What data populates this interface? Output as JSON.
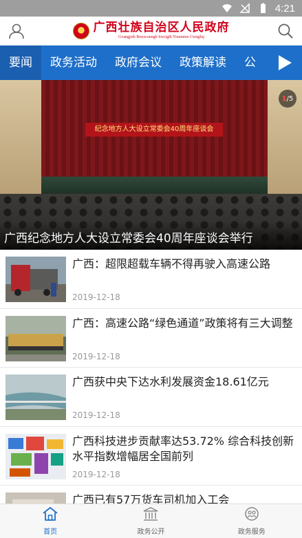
{
  "status_bar": {
    "time": "4:21",
    "icons": [
      "wifi-icon",
      "signal-off-icon",
      "battery-icon"
    ]
  },
  "header": {
    "title": "广西壮族自治区人民政府",
    "subtitle": "Gvangjsih Bouxcuengh Swcigih Yinzminz Cwngfuj",
    "left_icon": "user-icon",
    "right_icon": "search-icon"
  },
  "tabs": [
    {
      "label": "要闻",
      "active": true
    },
    {
      "label": "政务活动",
      "active": false
    },
    {
      "label": "政府会议",
      "active": false
    },
    {
      "label": "政策解读",
      "active": false
    },
    {
      "label": "公",
      "active": false
    }
  ],
  "hero": {
    "caption": "广西纪念地方人大设立常委会40周年座谈会举行",
    "banner_text": "纪念地方人大设立常委会40周年座谈会",
    "pager_current": "1",
    "pager_total": "/5"
  },
  "news": [
    {
      "title": "广西：超限超载车辆不得再驶入高速公路",
      "date": "2019-12-18",
      "thumb": "truck"
    },
    {
      "title": "广西：高速公路“绿色通道”政策将有三大调整",
      "date": "2019-12-18",
      "thumb": "highway"
    },
    {
      "title": "广西获中央下达水利发展资金18.61亿元",
      "date": "2019-12-18",
      "thumb": "river"
    },
    {
      "title": "广西科技进步贡献率达53.72% 综合科技创新水平指数增幅居全国前列",
      "date": "2019-12-18",
      "thumb": "tech"
    },
    {
      "title": "广西已有57万货车司机加入工会",
      "date": "",
      "thumb": "truck2"
    }
  ],
  "bottom_nav": [
    {
      "label": "首页",
      "icon": "home-icon",
      "active": true
    },
    {
      "label": "政务公开",
      "icon": "building-icon",
      "active": false
    },
    {
      "label": "政务服务",
      "icon": "service-icon",
      "active": false
    }
  ],
  "colors": {
    "brand_blue": "#1e6fc9",
    "brand_red": "#d0021b",
    "date_gray": "#999999"
  }
}
